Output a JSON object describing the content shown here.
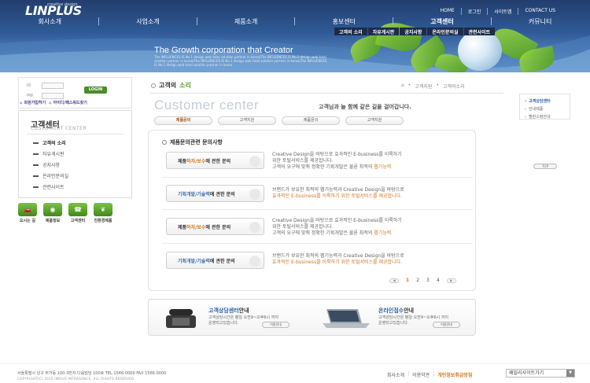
{
  "header": {
    "logo": "LINPLUS",
    "logo_sub": "creative design",
    "top_links": [
      "HOME",
      "로그인",
      "사이트맵",
      "CONTACT US"
    ],
    "gnb": [
      "회사소개",
      "사업소개",
      "제품소개",
      "홍보센터",
      "고객센터",
      "커뮤니티"
    ],
    "subnav": [
      "고객의 소리",
      "자유게시판",
      "공지사항",
      "온라인문의실",
      "관련사이트"
    ],
    "hero_title": "The Growth corporation that Creator",
    "hero_sub": "The INFLUENCES IS No.1 design web total solution partner in korea/The INFLUENCES IS No.1 design web total solution partner in korea/The INFLUENCES IS No.1 design web total solution partner in korea/The INFLUENCES IS No.1 design web total solution partner in korea"
  },
  "login": {
    "id_label": "ID",
    "pw_label": "PW",
    "button": "LOGIN",
    "links": [
      "회원가입하기",
      "아이디/패스워드찾기"
    ]
  },
  "lnb": {
    "title": "고객센터",
    "eng": "CUSTOMERT CENTER",
    "items": [
      "고객의 소리",
      "자유게시판",
      "공지사항",
      "온라인문의실",
      "관련사이트"
    ]
  },
  "quick": [
    "오시는 길",
    "제품정보",
    "고객센터",
    "친환경제품"
  ],
  "content": {
    "title_a": "고객의",
    "title_b": "소리",
    "breadcrumb": [
      "고객지원",
      "고객의소리"
    ],
    "cs_title": "Customer center",
    "slogan": "고객님과 늘 함께 같은 길을 걸어갑니다.",
    "tabs": [
      "제품문의",
      "고객지원",
      "제품문의",
      "고객지원"
    ],
    "panel_title": "제품문의관련 문의사항",
    "questions": [
      {
        "pre": "제품",
        "hl": "하자/보수",
        "post": "에 관한 문의",
        "hlcolor": "orange",
        "desc1": "Creative Design을 바탕으로 효과적인 E-business를 이룩하기",
        "desc2": "위한 토털서비스를 제공합니다.",
        "desc3a": "고객의 요구에 맞춰 정확한 기획개발은 물론 최적의 ",
        "desc3b": "웹기능력"
      },
      {
        "pre": "기획개발/",
        "hl": "기술력",
        "post": "에 관한 문의",
        "hlcolor": "blue",
        "desc1": "브랜드가 보유한 최적의 웹기능력과 Creative Design을 바탕으로",
        "desc2": "효과적인 E-business를 이룩하기 위한 토털서비스를 제공합니다.",
        "desc3a": "",
        "desc3b": ""
      },
      {
        "pre": "제품",
        "hl": "하자/보수",
        "post": "에 관한 문의",
        "hlcolor": "orange",
        "desc1": "Creative Design을 바탕으로 효과적인 E-business를 이룩하기",
        "desc2": "위한 토털서비스를 제공합니다.",
        "desc3a": "고객의 요구에 맞춰 정확한 기획개발은 물론 최적의 ",
        "desc3b": "웹기능력"
      },
      {
        "pre": "기획개발/",
        "hl": "기술력",
        "post": "에 관한 문의",
        "hlcolor": "blue",
        "desc1": "브랜드가 보유한 최적의 웹기능력과 Creative Design을 바탕으로",
        "desc2": "효과적인 E-business를 이룩하기 위한 토털서비스를 제공합니다.",
        "desc3a": "",
        "desc3b": ""
      }
    ],
    "pager": [
      "1",
      "2",
      "3",
      "4"
    ]
  },
  "contact": {
    "phone_title_a": "고객상담센터",
    "phone_title_b": "안내",
    "phone_desc": "고객상담시간은 평일 오전9~오후6시 까지 운영되고있습니다.",
    "phone_btn": "이용안내",
    "online_title_a": "온라인접수",
    "online_title_b": "안내",
    "online_desc": "고객상담시간은 평일 오전9~오후6시 까지 운영되고있습니다.",
    "online_btn": "이용안내"
  },
  "rside": {
    "items": [
      "고객상담센터",
      "안내제품",
      "벨런스정안내"
    ],
    "top": "TOP"
  },
  "footer": {
    "addr": "서울특별시 남구 무거동 100-3번지 다음빌딩 100호   TEL 1566-0000   FAX 1566-0000",
    "copy": "COPYRIGHT(C) 2010 INPLUS INFRAGENCE, ALL RIGHTS RESERVED",
    "links": [
      "회사소개",
      "이용약관",
      "개인정보취급방침"
    ],
    "family": "패밀리사이트가기"
  }
}
